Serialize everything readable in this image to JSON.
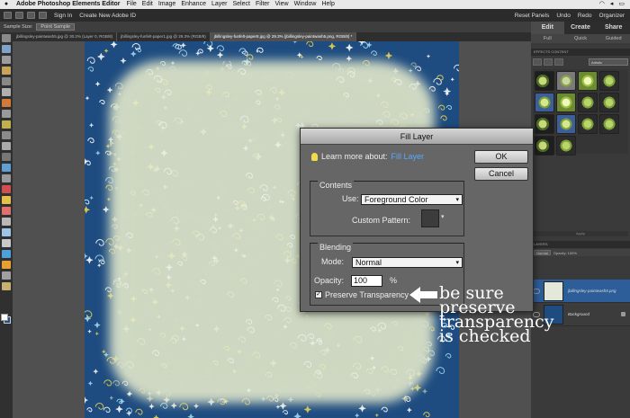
{
  "menubar": {
    "apple": "",
    "app_name": "Adobe Photoshop Elements Editor",
    "items": [
      "File",
      "Edit",
      "Image",
      "Enhance",
      "Layer",
      "Select",
      "Filter",
      "View",
      "Window",
      "Help"
    ]
  },
  "topbar": {
    "sign_in": "Sign In",
    "create_id": "Create New Adobe ID",
    "reset_panels": "Reset Panels",
    "undo": "Undo",
    "redo": "Redo",
    "organizer": "Organizer"
  },
  "options": {
    "sample_size_label": "Sample Size:",
    "sample_size_value": "Point Sample"
  },
  "doc_tabs": [
    "jbillingsley-paintwash5.jpg @ 30.2% (Layer 0, RGB/8)",
    "jbillingsley-funfelt-paper1.jpg @ 29.3% (RGB/8)",
    "jbillingsley-funfelt-paper8.jpg @ 29.3% (jbillingsley-paintwash5.png, RGB/8) *"
  ],
  "panel": {
    "tabs": [
      "Edit",
      "Create",
      "Share"
    ],
    "subtabs": [
      "Full",
      "Quick",
      "Guided"
    ],
    "effects_header": "EFFECTS  CONTENT",
    "effects_select": "Artistic",
    "apply_label": "Apply",
    "layers_header": "LAYERS",
    "blend_mode": "Normal",
    "opacity_text": "Opacity: 100%",
    "layers": [
      {
        "name": "jbillingsley-paintwash5.png"
      },
      {
        "name": "Background"
      }
    ]
  },
  "dialog": {
    "title": "Fill Layer",
    "learn_prefix": "Learn more about:",
    "learn_link": "Fill Layer",
    "ok_label": "OK",
    "cancel_label": "Cancel",
    "contents_label": "Contents",
    "use_label": "Use:",
    "use_value": "Foreground Color",
    "custom_pattern_label": "Custom Pattern:",
    "blending_label": "Blending",
    "mode_label": "Mode:",
    "mode_value": "Normal",
    "opacity_label": "Opacity:",
    "opacity_value": "100",
    "percent": "%",
    "preserve_label": "Preserve Transparency",
    "preserve_checked": true
  },
  "annotation": {
    "lines": [
      "be sure",
      "preserve",
      "transparency",
      "is checked"
    ]
  },
  "colors": {
    "canvas_blue": "#1e4c80",
    "link_blue": "#58a8ff",
    "layer_selected": "#2d5e99"
  }
}
